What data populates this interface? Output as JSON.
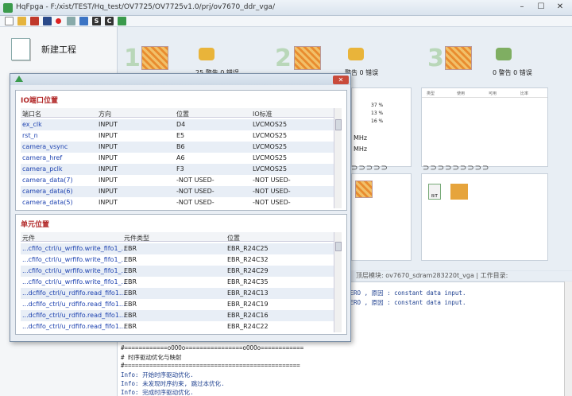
{
  "window": {
    "title": "HqFpga - F:/xist/TEST/Hq_test/OV7725/OV7725v1.0/prj/ov7670_ddr_vga/",
    "min": "–",
    "max": "☐",
    "close": "✕"
  },
  "toolbar": {
    "icons": [
      "new-file-icon",
      "open-folder-icon",
      "flag-red-icon",
      "flag-uk-icon",
      "record-icon",
      "tool-icon",
      "save-icon",
      "s-icon",
      "c-icon",
      "chart-icon"
    ]
  },
  "left_pane": {
    "new_project": "新建工程"
  },
  "flow": {
    "steps": [
      {
        "num": "1",
        "stats": "25 警告 0 错误"
      },
      {
        "num": "2",
        "stats": "警告 0 错误"
      },
      {
        "num": "3",
        "stats": "0 警告 0 错误"
      }
    ],
    "card2": {
      "pct1": "37 %",
      "pct2": "13 %",
      "pct3": "16 %",
      "mhz1": "MHz",
      "mhz2": "MHz"
    },
    "card3": {
      "headers": [
        "类型",
        "使用",
        "可用",
        "比率"
      ]
    },
    "bit_label": "BIT"
  },
  "info_bar": "顶层模块: ov7670_sdram283220t_vga  |  工作目录:",
  "console": {
    "lines": [
      "ZERO , 原因 : constant data input.",
      "ZERO , 原因 : constant data input.",
      "#============oOOOo================oOOOo============",
      "# 时序驱动优化与映射",
      "#=================================================",
      "Info: 开始时序驱动优化.",
      "Info:    未发现时序约束, 跳过本优化.",
      "Info: 完成时序驱动优化."
    ]
  },
  "dialog": {
    "close": "✕",
    "io_section": {
      "title": "IO端口位置",
      "headers": [
        "端口名",
        "方向",
        "位置",
        "IO标准"
      ],
      "rows": [
        [
          "ex_clk",
          "INPUT",
          "D4",
          "LVCMOS25"
        ],
        [
          "rst_n",
          "INPUT",
          "E5",
          "LVCMOS25"
        ],
        [
          "camera_vsync",
          "INPUT",
          "B6",
          "LVCMOS25"
        ],
        [
          "camera_href",
          "INPUT",
          "A6",
          "LVCMOS25"
        ],
        [
          "camera_pclk",
          "INPUT",
          "F3",
          "LVCMOS25"
        ],
        [
          "camera_data(7)",
          "INPUT",
          "-NOT USED-",
          "-NOT USED-"
        ],
        [
          "camera_data(6)",
          "INPUT",
          "-NOT USED-",
          "-NOT USED-"
        ],
        [
          "camera_data(5)",
          "INPUT",
          "-NOT USED-",
          "-NOT USED-"
        ]
      ]
    },
    "cell_section": {
      "title": "单元位置",
      "headers": [
        "元件",
        "元件类型",
        "位置"
      ],
      "rows": [
        [
          "...cfifo_ctrl/u_wrfifo.write_fifo1_...",
          "EBR",
          "EBR_R24C25"
        ],
        [
          "...cfifo_ctrl/u_wrfifo.write_fifo1_...",
          "EBR",
          "EBR_R24C32"
        ],
        [
          "...cfifo_ctrl/u_wrfifo.write_fifo1_...",
          "EBR",
          "EBR_R24C29"
        ],
        [
          "...cfifo_ctrl/u_wrfifo.write_fifo1_...",
          "EBR",
          "EBR_R24C35"
        ],
        [
          "...dcfifo_ctrl/u_rdfifo.read_fifo1...",
          "EBR",
          "EBR_R24C13"
        ],
        [
          "...dcfifo_ctrl/u_rdfifo.read_fifo1...",
          "EBR",
          "EBR_R24C19"
        ],
        [
          "...dcfifo_ctrl/u_rdfifo.read_fifo1...",
          "EBR",
          "EBR_R24C16"
        ],
        [
          "...dcfifo_ctrl/u_rdfifo.read_fifo1...",
          "EBR",
          "EBR_R24C22"
        ]
      ]
    }
  }
}
